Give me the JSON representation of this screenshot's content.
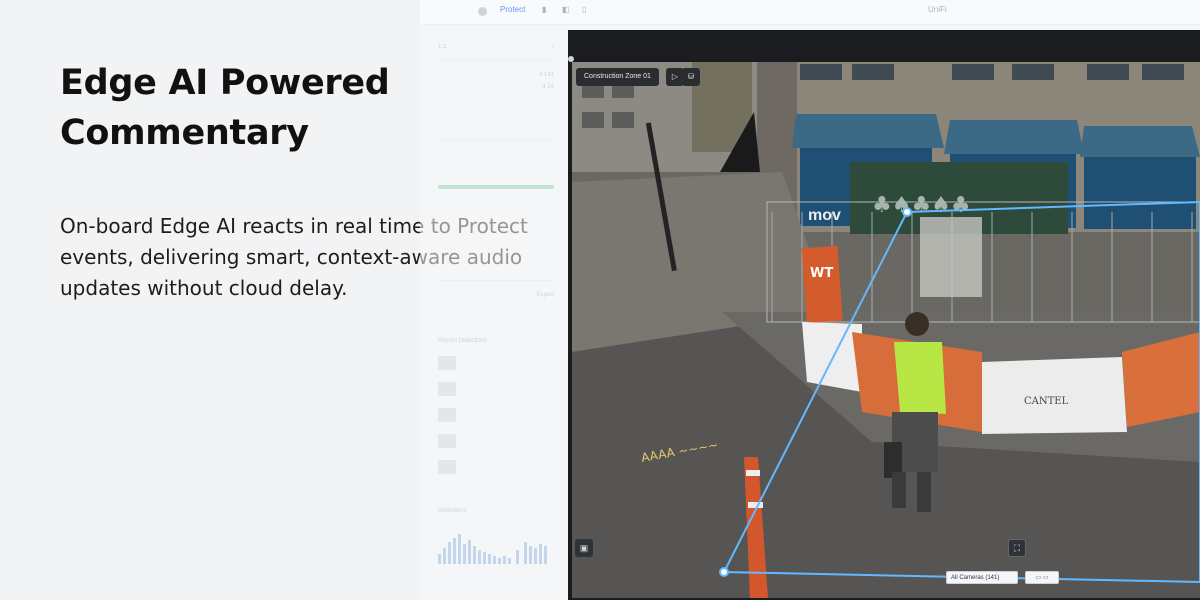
{
  "hero": {
    "title": "Edge AI Powered Commentary",
    "body": "On-board Edge AI reacts in real time to Protect events, delivering smart, context-aware audio updates without cloud delay."
  },
  "app": {
    "top_bar": {
      "protect_label": "Protect",
      "center_label": "UniFi"
    },
    "sidebar": {
      "zoom": "1:1",
      "chip_counts": [
        "4 141",
        "4 24"
      ],
      "sections": [
        "Recent Detections",
        "Detections"
      ],
      "export_label": "Export"
    },
    "viewer": {
      "zone_label": "Construction Zone 01",
      "camera_select": "All Cameras (141)",
      "camera_sign": "CANTEL",
      "store_sign": "mov",
      "banner_sign": "WT"
    }
  },
  "colors": {
    "page_bg": "#f2f3f5",
    "headline": "#111111",
    "zone_line": "#63b8ff",
    "viewer_bg": "#1a1c1f"
  }
}
